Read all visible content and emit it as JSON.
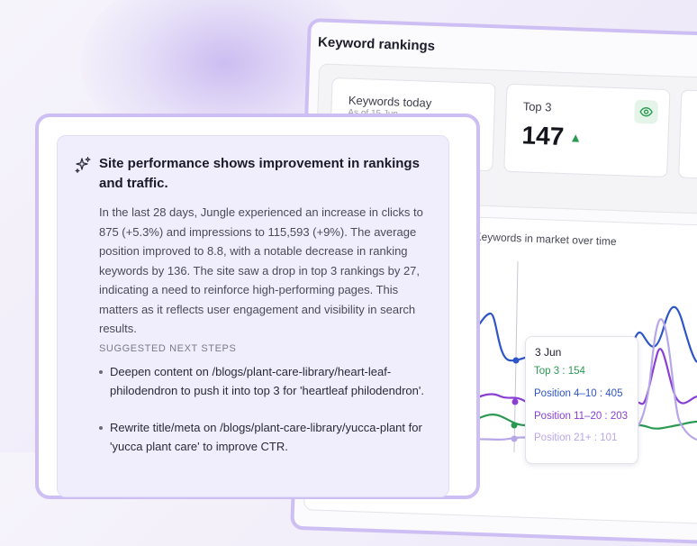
{
  "rankings": {
    "title": "Keyword rankings",
    "keywords_today": {
      "label": "Keywords today",
      "sub": "As of 15 Jun"
    },
    "top3": {
      "label": "Top 3",
      "value": "147"
    },
    "chart_caption": "Keywords in market over time"
  },
  "tooltip": {
    "date": "3 Jun",
    "rows": [
      {
        "label": "Top 3 : 154"
      },
      {
        "label": "Position 4–10 : 405"
      },
      {
        "label": "Position 11–20 : 203"
      },
      {
        "label": "Position 21+ : 101"
      }
    ]
  },
  "summary": {
    "headline": "Site performance shows improvement in rankings and traffic.",
    "body": "In the last 28 days, Jungle experienced an increase in clicks to 875 (+5.3%) and impressions to 115,593 (+9%). The average position improved to 8.8, with a notable decrease in ranking keywords by 136. The site saw a drop in top 3 rankings by 27, indicating a need to reinforce high-performing pages. This matters as it reflects user engagement and visibility in search results.",
    "steps_heading": "SUGGESTED NEXT STEPS",
    "steps": [
      "Deepen content on /blogs/plant-care-library/heart-leaf-philodendron to push it into top 3 for 'heartleaf philodendron'.",
      "Rewrite title/meta on /blogs/plant-care-library/yucca-plant for 'yucca plant care' to improve CTR."
    ]
  },
  "colors": {
    "top3": "#2a9a52",
    "pos4_10": "#2e55c8",
    "pos11_20": "#8a3fd4",
    "pos21": "#b7a7e8",
    "panel_border": "#cdbff3"
  }
}
